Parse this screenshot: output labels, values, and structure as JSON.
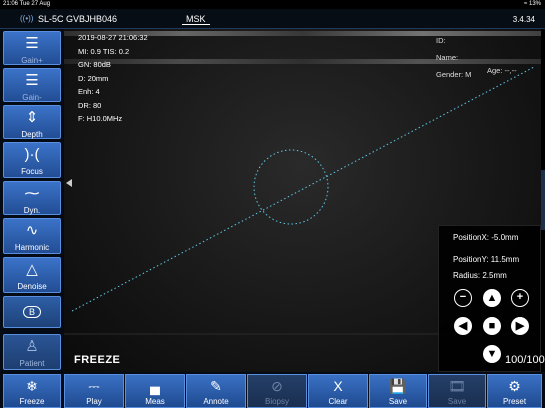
{
  "status": {
    "time": "21:06  Tue 27 Aug",
    "battery": "13%"
  },
  "header": {
    "probe": "SL-5C GVBJHB046",
    "preset": "MSK",
    "version": "3.4.34"
  },
  "sidebar": {
    "gain_up": "Gain+",
    "gain_down": "Gain-",
    "depth": "Depth",
    "focus": "Focus",
    "dyn": "Dyn.",
    "harmonic": "Harmonic",
    "denoise": "Denoise",
    "b_mode": "B",
    "patient": "Patient"
  },
  "image": {
    "datetime": "2019-08-27 21:06:32",
    "mi_tis": "MI: 0.9  TIS: 0.2",
    "gain": "GN: 80dB",
    "depth": "D: 20mm",
    "enh": "Enh: 4",
    "dr": "DR: 80",
    "freq": "F: H10.0MHz",
    "id_label": "ID:",
    "name_label": "Name:",
    "gender": "Gender: M",
    "age": "Age: --,--",
    "freeze_label": "FREEZE"
  },
  "panel": {
    "position_x": "PositionX: -5.0mm",
    "position_y": "PositionY: 11.5mm",
    "radius": "Radius: 2.5mm",
    "counter": "100/100"
  },
  "toolbar": {
    "freeze": "Freeze",
    "play": "Play",
    "meas": "Meas",
    "annote": "Annote",
    "biopsy": "Biopsy",
    "clear": "Clear",
    "save": "Save",
    "save2": "Save",
    "preset": "Preset"
  },
  "colors": {
    "accent": "#3a71c4",
    "guide_line": "#5fc8e6"
  }
}
